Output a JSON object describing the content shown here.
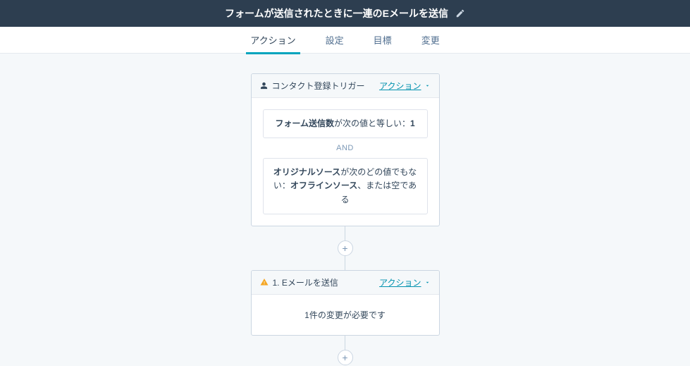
{
  "header": {
    "title": "フォームが送信されたときに一連のEメールを送信"
  },
  "tabs": {
    "action": "アクション",
    "settings": "設定",
    "goals": "目標",
    "changes": "変更"
  },
  "actionsLabel": "アクション",
  "trigger": {
    "title": "コンタクト登録トリガー",
    "cond1_bold": "フォーム送信数",
    "cond1_rest": "が次の値と等しい：",
    "cond1_val": "1",
    "and": "AND",
    "cond2_bold1": "オリジナルソース",
    "cond2_mid": "が次のどの値でもない：",
    "cond2_bold2": "オフラインソース",
    "cond2_tail": "、または空である"
  },
  "step1": {
    "title": "1. Eメールを送信",
    "body": "1件の変更が必要です"
  },
  "plus": "+"
}
